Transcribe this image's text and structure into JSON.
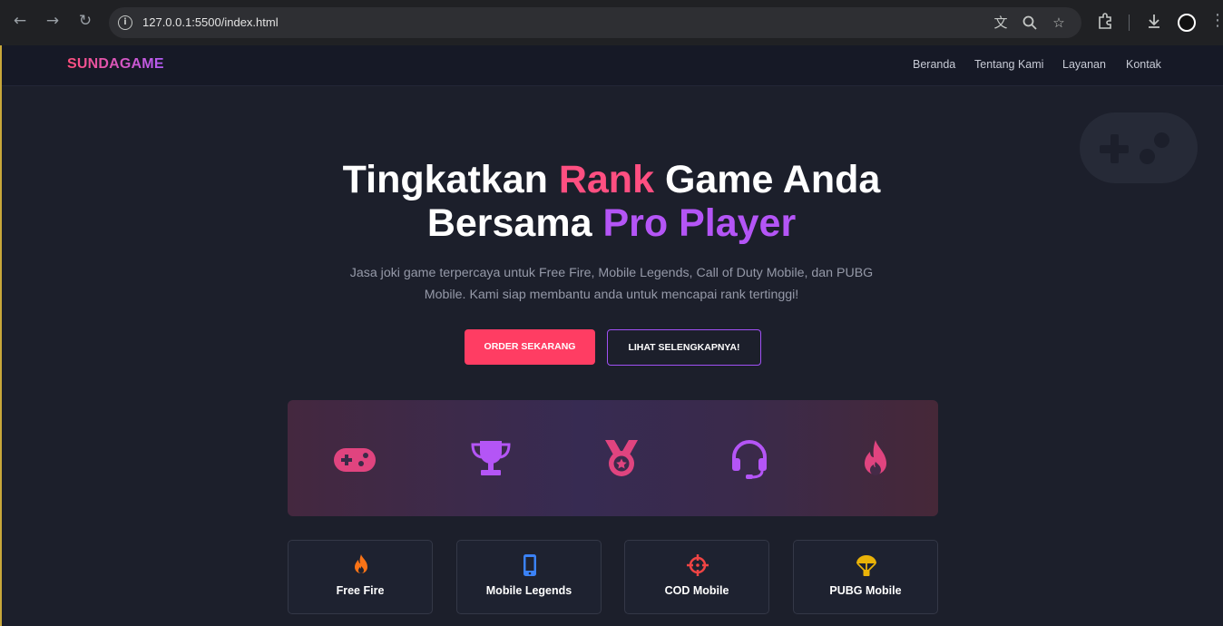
{
  "browser": {
    "url": "127.0.0.1:5500/index.html",
    "icons": [
      "back-icon",
      "forward-icon",
      "reload-icon",
      "site-info-icon",
      "translate-icon",
      "zoom-icon",
      "bookmark-star-icon",
      "extensions-icon",
      "download-icon",
      "profile-avatar",
      "menu-icon"
    ]
  },
  "nav": {
    "logo": "SUNDAGAME",
    "links": [
      "Beranda",
      "Tentang Kami",
      "Layanan",
      "Kontak"
    ]
  },
  "hero": {
    "line1_a": "Tingkatkan ",
    "line1_b": "Rank",
    "line1_c": " Game Anda",
    "line2_a": "Bersama ",
    "line2_b": "Pro Player",
    "subtitle": "Jasa joki game terpercaya untuk Free Fire, Mobile Legends, Call of Duty Mobile, dan PUBG Mobile. Kami siap membantu anda untuk mencapai rank tertinggi!",
    "primary_button": "ORDER SEKARANG",
    "secondary_button": "LIHAT SELENGKAPNYA!"
  },
  "banner_icons": [
    "gamepad-icon",
    "trophy-icon",
    "medal-icon",
    "headset-icon",
    "fire-icon"
  ],
  "games": [
    {
      "label": "Free Fire",
      "icon": "fire-icon",
      "color": "#f97316"
    },
    {
      "label": "Mobile Legends",
      "icon": "mobile-icon",
      "color": "#3b82f6"
    },
    {
      "label": "COD Mobile",
      "icon": "crosshairs-icon",
      "color": "#ef4444"
    },
    {
      "label": "PUBG Mobile",
      "icon": "parachute-icon",
      "color": "#eab308"
    }
  ],
  "colors": {
    "accent_pink": "#ff3d63",
    "accent_purple": "#b455f6",
    "background": "#1c1f2b"
  }
}
